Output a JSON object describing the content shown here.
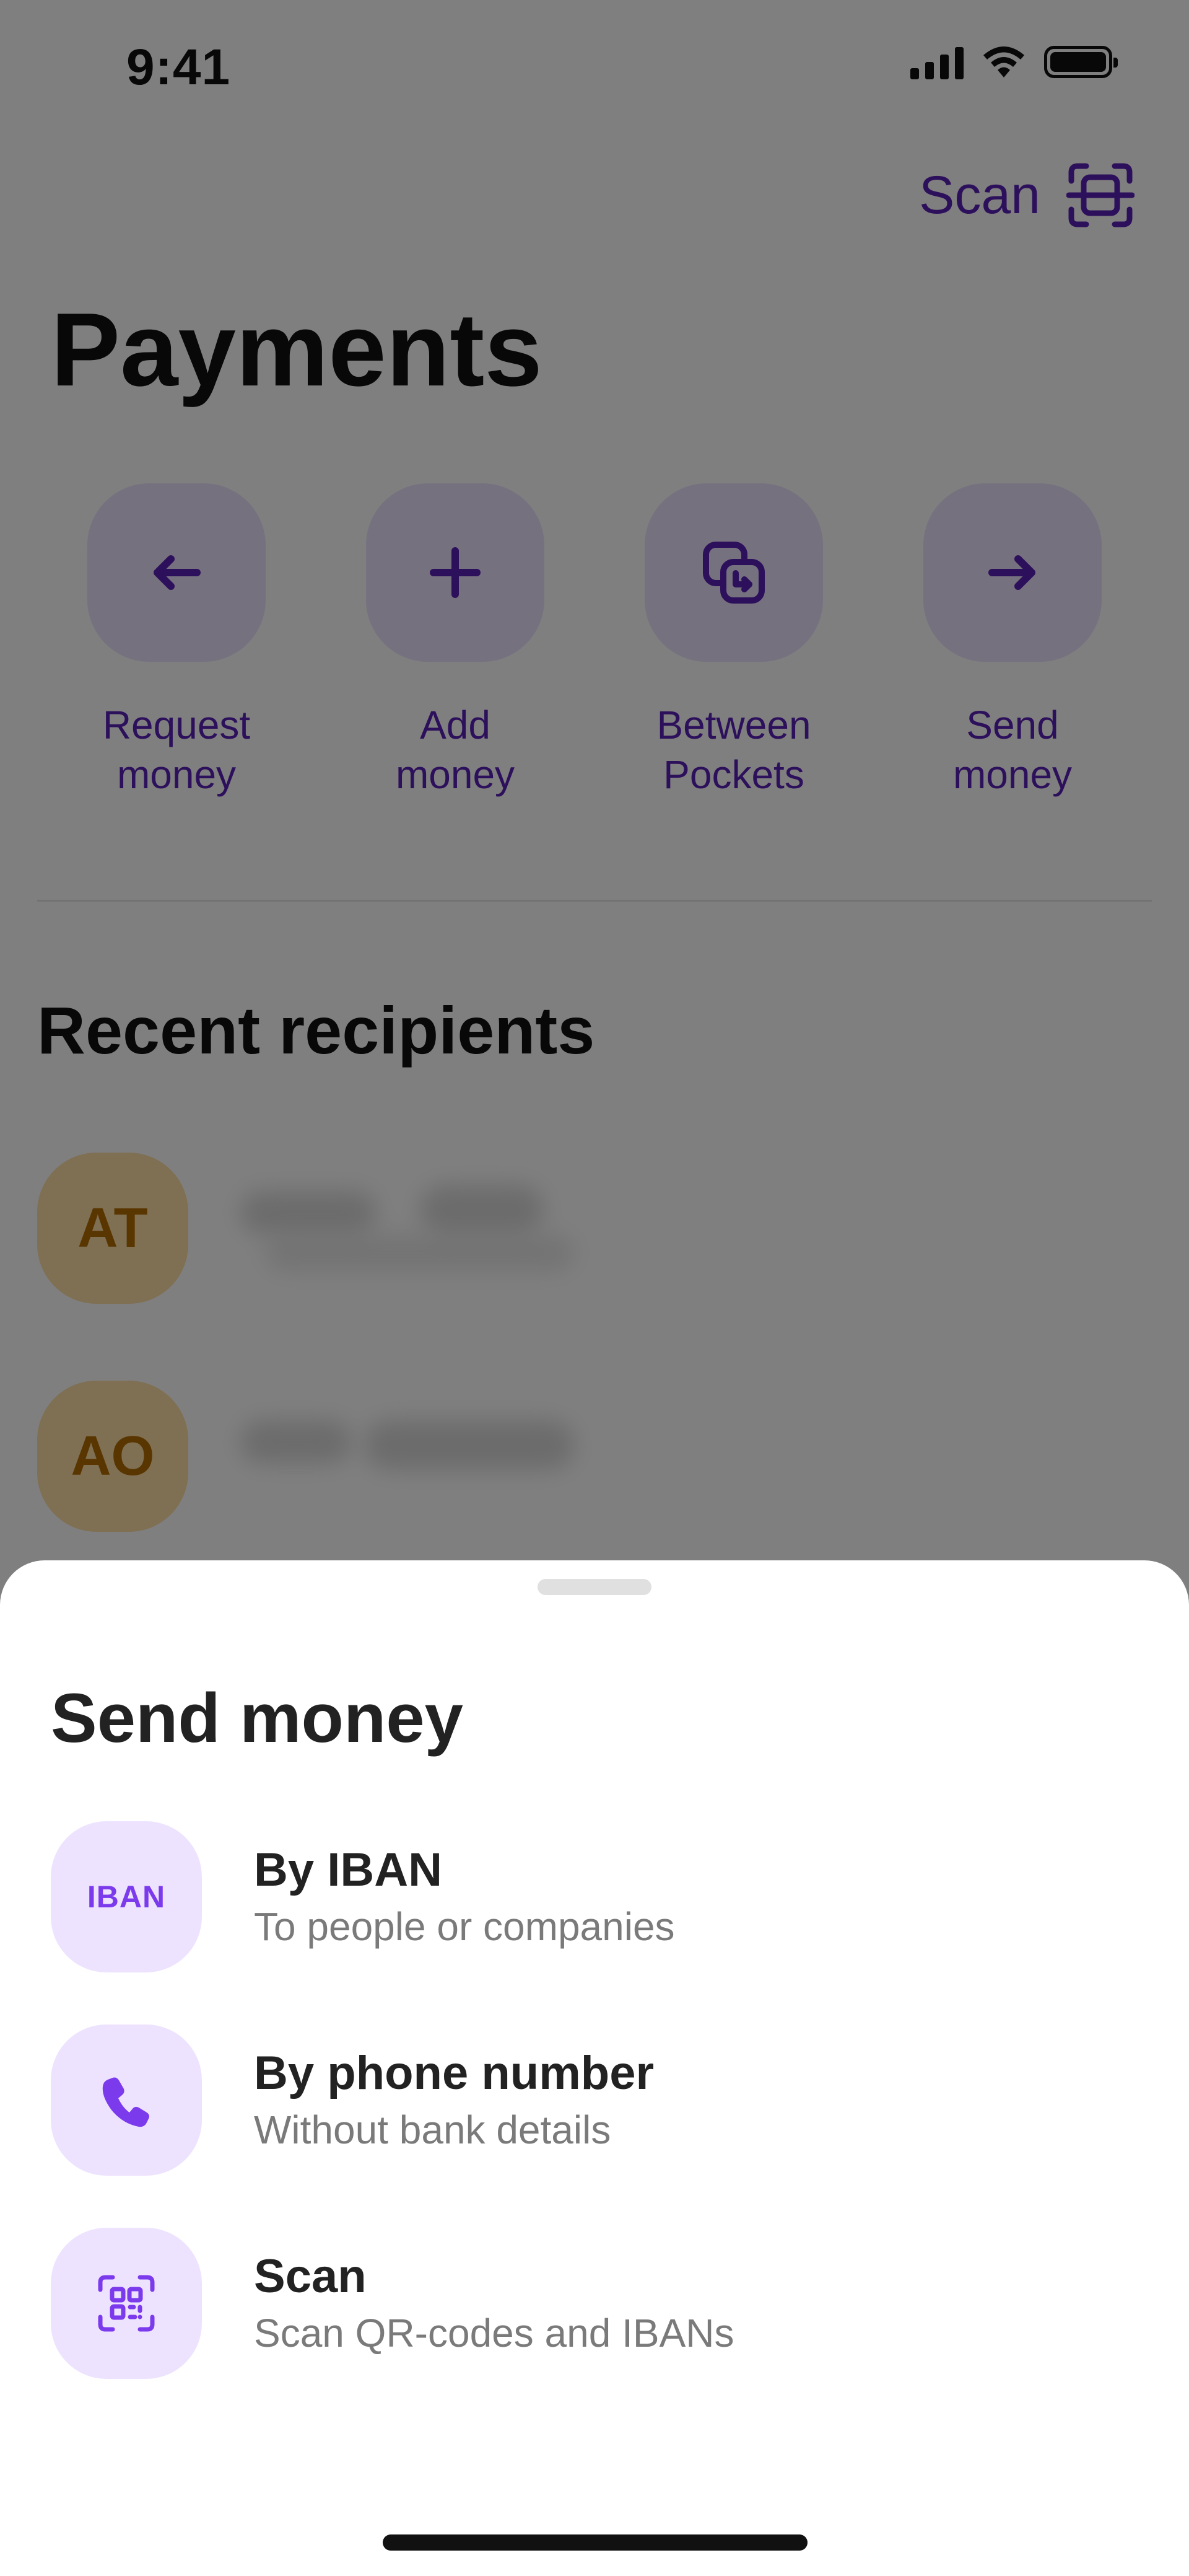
{
  "status_bar": {
    "time": "9:41"
  },
  "header": {
    "scan_label": "Scan"
  },
  "page": {
    "title": "Payments"
  },
  "actions": [
    {
      "label_line1": "Request",
      "label_line2": "money",
      "icon": "arrow-left-icon"
    },
    {
      "label_line1": "Add",
      "label_line2": "money",
      "icon": "plus-icon"
    },
    {
      "label_line1": "Between",
      "label_line2": "Pockets",
      "icon": "pockets-transfer-icon"
    },
    {
      "label_line1": "Send",
      "label_line2": "money",
      "icon": "arrow-right-icon"
    }
  ],
  "recent": {
    "title": "Recent recipients",
    "recipients": [
      {
        "initials": "AT"
      },
      {
        "initials": "AO"
      }
    ]
  },
  "sheet": {
    "title": "Send money",
    "options": [
      {
        "title": "By IBAN",
        "subtitle": "To people or companies",
        "icon_text": "IBAN"
      },
      {
        "title": "By phone number",
        "subtitle": "Without bank details",
        "icon": "phone-icon"
      },
      {
        "title": "Scan",
        "subtitle": "Scan QR-codes and IBANs",
        "icon": "qr-scan-icon"
      }
    ]
  },
  "colors": {
    "accent": "#5b21b6",
    "accent_light": "#ede3ff",
    "avatar_bg": "#ffdfa6",
    "avatar_text": "#b26a00",
    "overlay": "rgba(0,0,0,0.5)"
  }
}
